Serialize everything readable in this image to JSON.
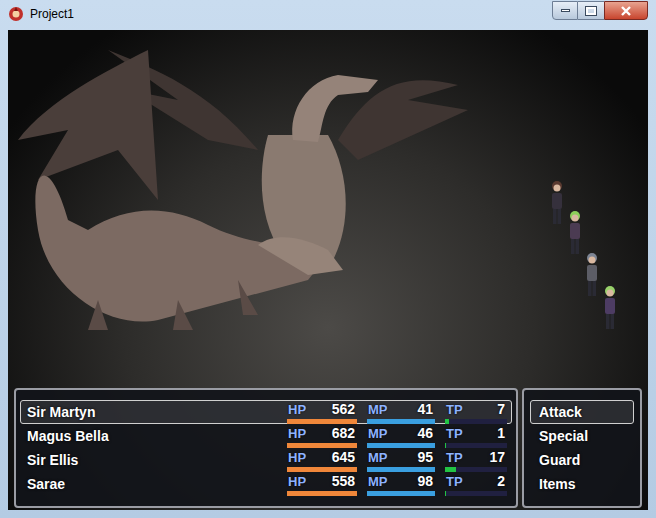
{
  "window": {
    "title": "Project1"
  },
  "party": [
    {
      "name": "Sir Martyn",
      "selected": true,
      "gauges": [
        {
          "label": "HP",
          "value": "562",
          "level": 1,
          "color": "#f0873a"
        },
        {
          "label": "MP",
          "value": "41",
          "level": 1,
          "color": "#3a9fe0"
        },
        {
          "label": "TP",
          "value": "7",
          "level": 0.07,
          "color": "#22c444"
        }
      ]
    },
    {
      "name": "Magus Bella",
      "selected": false,
      "gauges": [
        {
          "label": "HP",
          "value": "682",
          "level": 1,
          "color": "#f0873a"
        },
        {
          "label": "MP",
          "value": "46",
          "level": 1,
          "color": "#3a9fe0"
        },
        {
          "label": "TP",
          "value": "1",
          "level": 0.01,
          "color": "#22c444"
        }
      ]
    },
    {
      "name": "Sir Ellis",
      "selected": false,
      "gauges": [
        {
          "label": "HP",
          "value": "645",
          "level": 1,
          "color": "#f0873a"
        },
        {
          "label": "MP",
          "value": "95",
          "level": 1,
          "color": "#3a9fe0"
        },
        {
          "label": "TP",
          "value": "17",
          "level": 0.17,
          "color": "#22c444"
        }
      ]
    },
    {
      "name": "Sarae",
      "selected": false,
      "gauges": [
        {
          "label": "HP",
          "value": "558",
          "level": 1,
          "color": "#f0873a"
        },
        {
          "label": "MP",
          "value": "98",
          "level": 1,
          "color": "#3a9fe0"
        },
        {
          "label": "TP",
          "value": "2",
          "level": 0.02,
          "color": "#22c444"
        }
      ]
    }
  ],
  "commands": [
    {
      "label": "Attack",
      "selected": true
    },
    {
      "label": "Special",
      "selected": false
    },
    {
      "label": "Guard",
      "selected": false
    },
    {
      "label": "Items",
      "selected": false
    }
  ]
}
